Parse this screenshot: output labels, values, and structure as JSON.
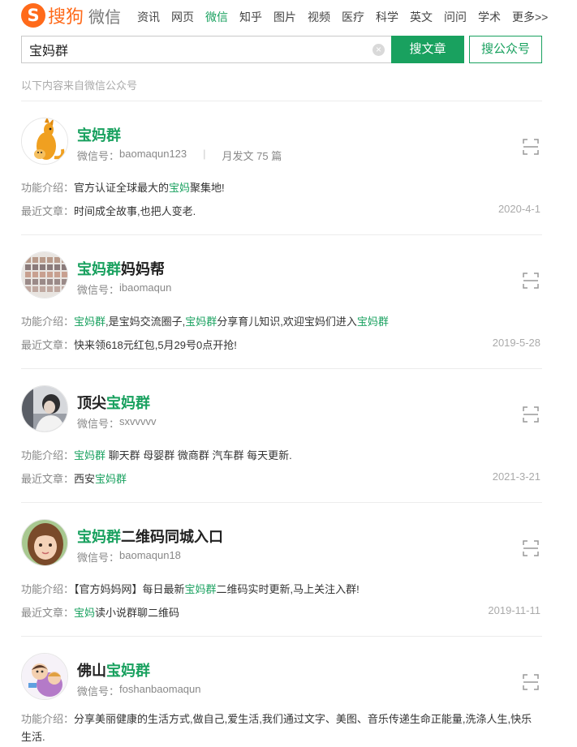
{
  "header": {
    "logo_badge": "S",
    "logo_text": "搜狗",
    "logo_sub": "微信",
    "nav": [
      "资讯",
      "网页",
      "微信",
      "知乎",
      "图片",
      "视频",
      "医疗",
      "科学",
      "英文",
      "问问",
      "学术",
      "更多>>"
    ],
    "nav_active": "微信"
  },
  "search": {
    "query": "宝妈群",
    "clear_glyph": "×",
    "article_button": "搜文章",
    "account_button": "搜公众号"
  },
  "source_note": "以下内容来自微信公众号",
  "labels": {
    "wechat_id": "微信号：",
    "intro": "功能介绍：",
    "recent": "最近文章："
  },
  "results": [
    {
      "title_pre": "",
      "title_hl": "宝妈群",
      "title_post": "",
      "wechat_id": "baomaqun123",
      "monthly": "月发文 75 篇",
      "intro_parts": [
        [
          "官方认证全球最大的",
          false
        ],
        [
          "宝妈",
          true
        ],
        [
          "聚集地!",
          false
        ]
      ],
      "recent_parts": [
        [
          "时间成全故事,也把人变老.",
          false
        ]
      ],
      "date": "2020-4-1"
    },
    {
      "title_pre": "",
      "title_hl": "宝妈群",
      "title_post": "妈妈帮",
      "wechat_id": "ibaomaqun",
      "monthly": "",
      "intro_parts": [
        [
          "宝妈群",
          true
        ],
        [
          ",是宝妈交流圈子,",
          false
        ],
        [
          "宝妈群",
          true
        ],
        [
          "分享育儿知识,欢迎宝妈们进入",
          false
        ],
        [
          "宝妈群",
          true
        ]
      ],
      "recent_parts": [
        [
          "快来领618元红包,5月29号0点开抢!",
          false
        ]
      ],
      "date": "2019-5-28"
    },
    {
      "title_pre": "顶尖",
      "title_hl": "宝妈群",
      "title_post": "",
      "wechat_id": "sxvvvvv",
      "monthly": "",
      "intro_parts": [
        [
          "宝妈群",
          true
        ],
        [
          " 聊天群 母婴群 微商群 汽车群 每天更新.",
          false
        ]
      ],
      "recent_parts": [
        [
          "西安",
          false
        ],
        [
          "宝妈群",
          true
        ]
      ],
      "date": "2021-3-21"
    },
    {
      "title_pre": "",
      "title_hl": "宝妈群",
      "title_post": "二维码同城入口",
      "wechat_id": "baomaqun18",
      "monthly": "",
      "intro_parts": [
        [
          "【官方妈妈网】每日最新",
          false
        ],
        [
          "宝妈群",
          true
        ],
        [
          "二维码实时更新,马上关注入群!",
          false
        ]
      ],
      "recent_parts": [
        [
          "宝妈",
          true
        ],
        [
          "读小说群聊二维码",
          false
        ]
      ],
      "date": "2019-11-11"
    },
    {
      "title_pre": "佛山",
      "title_hl": "宝妈群",
      "title_post": "",
      "wechat_id": "foshanbaomaqun",
      "monthly": "",
      "intro_parts": [
        [
          "分享美丽健康的生活方式,做自己,爱生活,我们通过文字、美图、音乐传递生命正能量,洗涤人生,快乐生活.",
          false
        ]
      ],
      "recent_parts": [],
      "date": ""
    }
  ],
  "colors": {
    "accent": "#19a15f",
    "brand": "#ff6a1a"
  }
}
